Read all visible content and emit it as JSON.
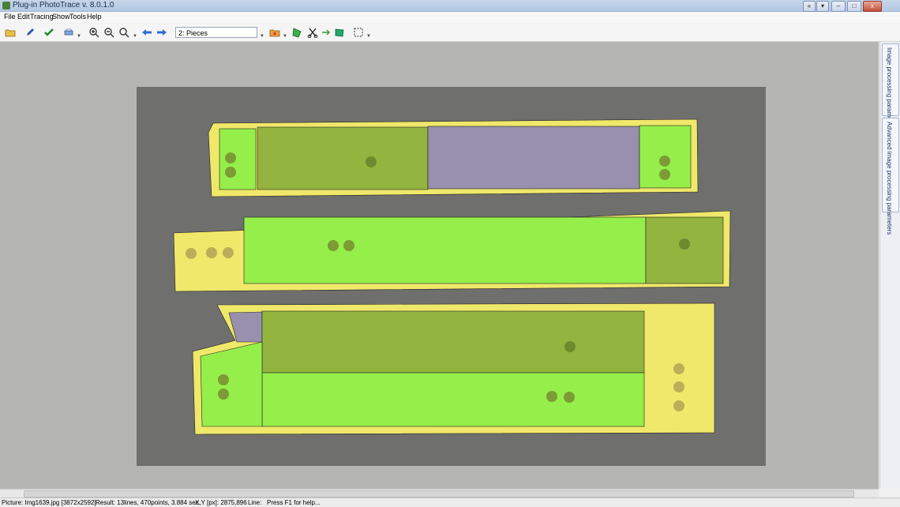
{
  "window": {
    "title": "Plug-in PhotoTrace v. 8.0.1.0"
  },
  "window_controls": {
    "pin": "«",
    "minimize": "–",
    "maximize": "□",
    "close": "x"
  },
  "menu": [
    "File",
    "Edit",
    "Tracing",
    "Show",
    "Tools",
    "Help"
  ],
  "toolbar": {
    "layer_select": "2: Pieces",
    "icons": [
      "open-folder-icon",
      "pen-icon",
      "checkmark-icon",
      "print-icon",
      "zoom-in-icon",
      "zoom-out-icon",
      "zoom-fit-icon",
      "arrow-left-icon",
      "arrow-right-icon",
      "palette-folder-icon",
      "polygon-icon",
      "scissors-icon",
      "arrow-to-shape-icon",
      "selection-rect-icon"
    ]
  },
  "side_tabs": [
    "Image processing parameters",
    "Advanced image processing parameters"
  ],
  "status": {
    "picture": "Picture: Img1639.jpg [3872x2592]",
    "result": "Result: 13lines, 470points, 3.884 sec.",
    "xy": "X,Y [px]: 2875,896",
    "line": "Line:",
    "help": "Press F1 for help..."
  },
  "colors": {
    "board": "#6d6d6b",
    "outline_yellow": "#f0e86a",
    "piece_green": "#95ee4a",
    "piece_olive": "#93b43f",
    "piece_lavender": "#9890ac",
    "hole": "#7c9b35"
  }
}
